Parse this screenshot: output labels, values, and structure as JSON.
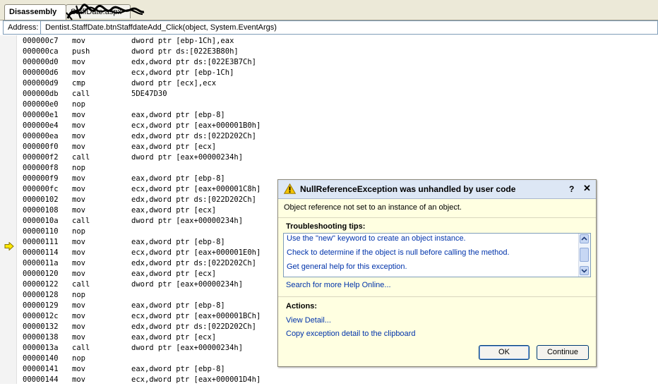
{
  "tabs": [
    {
      "label": "Disassembly",
      "active": true
    },
    {
      "label": "StaffDate.aspx",
      "active": false
    }
  ],
  "address": {
    "label": "Address:",
    "value": "Dentist.StaffDate.btnStaffdateAdd_Click(object, System.EventArgs)"
  },
  "disassembly": [
    [
      "000000c7",
      "mov",
      "dword ptr [ebp-1Ch],eax"
    ],
    [
      "000000ca",
      "push",
      "dword ptr ds:[022E3B80h]"
    ],
    [
      "000000d0",
      "mov",
      "edx,dword ptr ds:[022E3B7Ch]"
    ],
    [
      "000000d6",
      "mov",
      "ecx,dword ptr [ebp-1Ch]"
    ],
    [
      "000000d9",
      "cmp",
      "dword ptr [ecx],ecx"
    ],
    [
      "000000db",
      "call",
      "5DE47D30"
    ],
    [
      "000000e0",
      "nop",
      ""
    ],
    [
      "000000e1",
      "mov",
      "eax,dword ptr [ebp-8]"
    ],
    [
      "000000e4",
      "mov",
      "ecx,dword ptr [eax+000001B0h]"
    ],
    [
      "000000ea",
      "mov",
      "edx,dword ptr ds:[022D202Ch]"
    ],
    [
      "000000f0",
      "mov",
      "eax,dword ptr [ecx]"
    ],
    [
      "000000f2",
      "call",
      "dword ptr [eax+00000234h]"
    ],
    [
      "000000f8",
      "nop",
      ""
    ],
    [
      "000000f9",
      "mov",
      "eax,dword ptr [ebp-8]"
    ],
    [
      "000000fc",
      "mov",
      "ecx,dword ptr [eax+000001C8h]"
    ],
    [
      "00000102",
      "mov",
      "edx,dword ptr ds:[022D202Ch]"
    ],
    [
      "00000108",
      "mov",
      "eax,dword ptr [ecx]"
    ],
    [
      "0000010a",
      "call",
      "dword ptr [eax+00000234h]"
    ],
    [
      "00000110",
      "nop",
      ""
    ],
    [
      "00000111",
      "mov",
      "eax,dword ptr [ebp-8]"
    ],
    [
      "00000114",
      "mov",
      "ecx,dword ptr [eax+000001E0h]"
    ],
    [
      "0000011a",
      "mov",
      "edx,dword ptr ds:[022D202Ch]"
    ],
    [
      "00000120",
      "mov",
      "eax,dword ptr [ecx]"
    ],
    [
      "00000122",
      "call",
      "dword ptr [eax+00000234h]"
    ],
    [
      "00000128",
      "nop",
      ""
    ],
    [
      "00000129",
      "mov",
      "eax,dword ptr [ebp-8]"
    ],
    [
      "0000012c",
      "mov",
      "ecx,dword ptr [eax+000001BCh]"
    ],
    [
      "00000132",
      "mov",
      "edx,dword ptr ds:[022D202Ch]"
    ],
    [
      "00000138",
      "mov",
      "eax,dword ptr [ecx]"
    ],
    [
      "0000013a",
      "call",
      "dword ptr [eax+00000234h]"
    ],
    [
      "00000140",
      "nop",
      ""
    ],
    [
      "00000141",
      "mov",
      "eax,dword ptr [ebp-8]"
    ],
    [
      "00000144",
      "mov",
      "ecx,dword ptr [eax+000001D4h]"
    ]
  ],
  "current_instruction_icon": "yellow-arrow-icon",
  "exception": {
    "title": "NullReferenceException was unhandled by user code",
    "help_glyph": "?",
    "close_glyph": "✕",
    "message": "Object reference not set to an instance of an object.",
    "tips_heading": "Troubleshooting tips:",
    "tips": [
      "Use the \"new\" keyword to create an object instance.",
      "Check to determine if the object is null before calling the method.",
      "Get general help for this exception."
    ],
    "help_online": "Search for more Help Online...",
    "actions_heading": "Actions:",
    "actions": [
      "View Detail...",
      "Copy exception detail to the clipboard"
    ],
    "ok_label": "OK",
    "continue_label": "Continue"
  },
  "colors": {
    "dialog_bg": "#ffffe1",
    "dialog_header": "#dde7f5",
    "link": "#0033aa",
    "warning": "#f5c400"
  }
}
